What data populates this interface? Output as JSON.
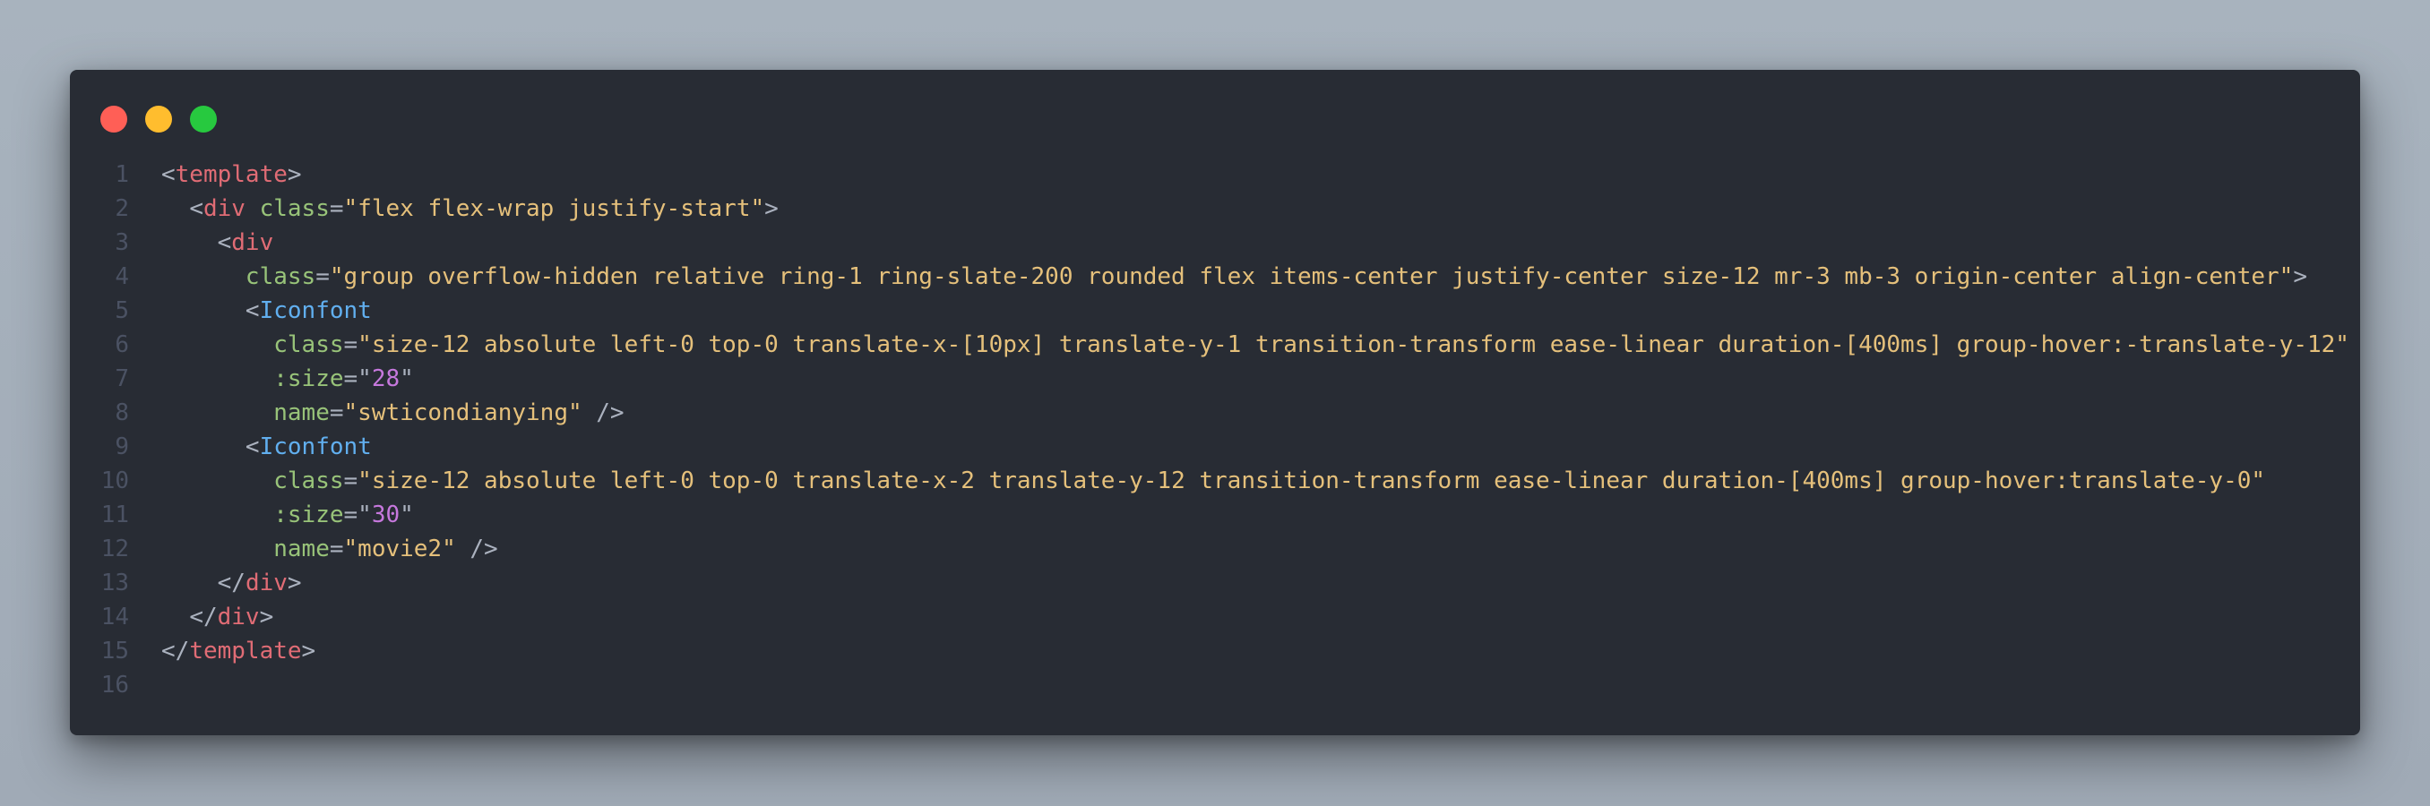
{
  "window": {
    "controls": [
      "close",
      "minimize",
      "maximize"
    ]
  },
  "code": {
    "lines": [
      {
        "n": "1",
        "indent": "",
        "tokens": [
          [
            "punct",
            "<"
          ],
          [
            "tag",
            "template"
          ],
          [
            "punct",
            ">"
          ]
        ]
      },
      {
        "n": "2",
        "indent": "  ",
        "tokens": [
          [
            "punct",
            "<"
          ],
          [
            "tag",
            "div"
          ],
          [
            "punct",
            " "
          ],
          [
            "attr",
            "class"
          ],
          [
            "punct",
            "="
          ],
          [
            "str",
            "\"flex flex-wrap justify-start\""
          ],
          [
            "punct",
            ">"
          ]
        ]
      },
      {
        "n": "3",
        "indent": "    ",
        "tokens": [
          [
            "punct",
            "<"
          ],
          [
            "tag",
            "div"
          ]
        ]
      },
      {
        "n": "4",
        "indent": "      ",
        "tokens": [
          [
            "attr",
            "class"
          ],
          [
            "punct",
            "="
          ],
          [
            "str",
            "\"group overflow-hidden relative ring-1 ring-slate-200 rounded flex items-center justify-center size-12 mr-3 mb-3 origin-center align-center\""
          ],
          [
            "punct",
            ">"
          ]
        ]
      },
      {
        "n": "5",
        "indent": "      ",
        "tokens": [
          [
            "punct",
            "<"
          ],
          [
            "comp",
            "Iconfont"
          ]
        ]
      },
      {
        "n": "6",
        "indent": "        ",
        "tokens": [
          [
            "attr",
            "class"
          ],
          [
            "punct",
            "="
          ],
          [
            "str",
            "\"size-12 absolute left-0 top-0 translate-x-[10px] translate-y-1 transition-transform ease-linear duration-[400ms] group-hover:-translate-y-12\""
          ]
        ]
      },
      {
        "n": "7",
        "indent": "        ",
        "tokens": [
          [
            "attr",
            ":size"
          ],
          [
            "punct",
            "=\""
          ],
          [
            "num",
            "28"
          ],
          [
            "punct",
            "\""
          ]
        ]
      },
      {
        "n": "8",
        "indent": "        ",
        "tokens": [
          [
            "attr",
            "name"
          ],
          [
            "punct",
            "="
          ],
          [
            "str",
            "\"swticondianying\""
          ],
          [
            "punct",
            " />"
          ]
        ]
      },
      {
        "n": "9",
        "indent": "      ",
        "tokens": [
          [
            "punct",
            "<"
          ],
          [
            "comp",
            "Iconfont"
          ]
        ]
      },
      {
        "n": "10",
        "indent": "        ",
        "tokens": [
          [
            "attr",
            "class"
          ],
          [
            "punct",
            "="
          ],
          [
            "str",
            "\"size-12 absolute left-0 top-0 translate-x-2 translate-y-12 transition-transform ease-linear duration-[400ms] group-hover:translate-y-0\""
          ]
        ]
      },
      {
        "n": "11",
        "indent": "        ",
        "tokens": [
          [
            "attr",
            ":size"
          ],
          [
            "punct",
            "=\""
          ],
          [
            "num",
            "30"
          ],
          [
            "punct",
            "\""
          ]
        ]
      },
      {
        "n": "12",
        "indent": "        ",
        "tokens": [
          [
            "attr",
            "name"
          ],
          [
            "punct",
            "="
          ],
          [
            "str",
            "\"movie2\""
          ],
          [
            "punct",
            " />"
          ]
        ]
      },
      {
        "n": "13",
        "indent": "    ",
        "tokens": [
          [
            "punct",
            "</"
          ],
          [
            "tag",
            "div"
          ],
          [
            "punct",
            ">"
          ]
        ]
      },
      {
        "n": "14",
        "indent": "  ",
        "tokens": [
          [
            "punct",
            "</"
          ],
          [
            "tag",
            "div"
          ],
          [
            "punct",
            ">"
          ]
        ]
      },
      {
        "n": "15",
        "indent": "",
        "tokens": [
          [
            "punct",
            "</"
          ],
          [
            "tag",
            "template"
          ],
          [
            "punct",
            ">"
          ]
        ]
      },
      {
        "n": "16",
        "indent": "",
        "tokens": []
      }
    ]
  },
  "colors": {
    "background": "#a8b3be",
    "editor_bg": "#282c34",
    "tag": "#e06c75",
    "component": "#61afef",
    "attribute": "#98c379",
    "string": "#e5c07b",
    "number": "#c678dd",
    "line_number": "#4b5263"
  }
}
